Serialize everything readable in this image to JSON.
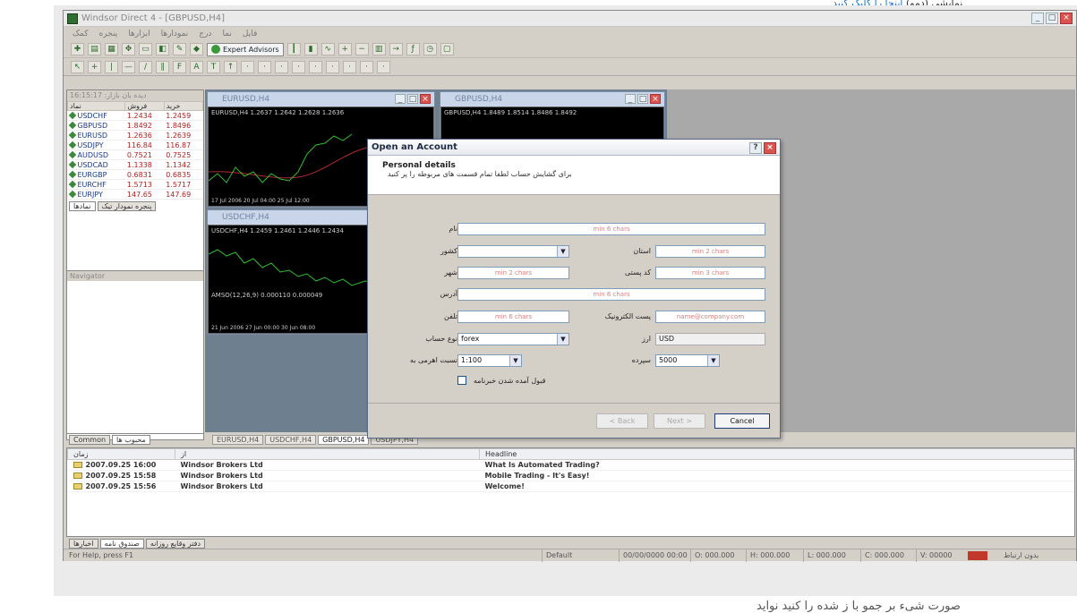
{
  "top_note": {
    "prefix": "نمایشی (دمو)",
    "link": "اینجا را کلیک کنید"
  },
  "window": {
    "title": "Windsor Direct 4 - [GBPUSD,H4]"
  },
  "menu": [
    "فایل",
    "نما",
    "درج",
    "نمودارها",
    "ابزارها",
    "پنجره",
    "کمک"
  ],
  "toolbar": {
    "expert_advisors": "Expert Advisors"
  },
  "market_watch": {
    "header": "دیده بان بازار: 16:15:17",
    "columns": [
      "نماد",
      "فروش",
      "خرید"
    ],
    "rows": [
      {
        "symbol": "USDCHF",
        "bid": "1.2434",
        "ask": "1.2459"
      },
      {
        "symbol": "GBPUSD",
        "bid": "1.8492",
        "ask": "1.8496"
      },
      {
        "symbol": "EURUSD",
        "bid": "1.2636",
        "ask": "1.2639"
      },
      {
        "symbol": "USDJPY",
        "bid": "116.84",
        "ask": "116.87"
      },
      {
        "symbol": "AUDUSD",
        "bid": "0.7521",
        "ask": "0.7525"
      },
      {
        "symbol": "USDCAD",
        "bid": "1.1338",
        "ask": "1.1342"
      },
      {
        "symbol": "EURGBP",
        "bid": "0.6831",
        "ask": "0.6835"
      },
      {
        "symbol": "EURCHF",
        "bid": "1.5713",
        "ask": "1.5717"
      },
      {
        "symbol": "EURJPY",
        "bid": "147.65",
        "ask": "147.69"
      }
    ],
    "tabs": [
      "نمادها",
      "پنجره نمودار تیک"
    ]
  },
  "navigator": {
    "header": "Navigator",
    "tabs": [
      "Common",
      "محبوب ها"
    ]
  },
  "charts": [
    {
      "title": "EURUSD,H4",
      "info": "EURUSD,H4 1.2637 1.2642 1.2628 1.2636",
      "time": "17 Jul 2006  20 Jul 04:00  25 Jul 12:00"
    },
    {
      "title": "GBPUSD,H4",
      "info": "GBPUSD,H4 1.8489 1.8514 1.8486 1.8492",
      "time": ""
    },
    {
      "title": "USDCHF,H4",
      "info": "USDCHF,H4 1.2459 1.2461 1.2446 1.2434",
      "time": "21 Jun 2006  27 Jun 00:00  30 Jun 08:00",
      "sub": "AMSO(12,26,9) 0.000110 0.000049"
    }
  ],
  "chart_tabs": [
    "EURUSD,H4",
    "USDCHF,H4",
    "GBPUSD,H4",
    "USDJPY,H4"
  ],
  "dialog": {
    "title": "Open an Account",
    "heading": "Personal details",
    "instruction": "برای گشایش حساب لطفا تمام قسمت های مربوطه را پر کنید",
    "labels": {
      "name": "نام",
      "country": "کشور",
      "state": "استان",
      "city": "شهر",
      "zip": "کد پستی",
      "address": "آدرس",
      "phone": "تلفن",
      "email": "پست الکترونیک",
      "account_type": "نوع حساب",
      "currency": "ارز",
      "leverage": "نسبت اهرمی به",
      "deposit": "سپرده",
      "newsletter": "قبول آمده شدن خبرنامه"
    },
    "placeholders": {
      "name": "min 6 chars",
      "state": "min 2 chars",
      "city": "min 2 chars",
      "zip": "min 3 chars",
      "address": "min 6 chars",
      "phone": "min 6 chars",
      "email": "name@company.com"
    },
    "values": {
      "account_type": "forex",
      "currency": "USD",
      "leverage": "1:100",
      "deposit": "5000"
    },
    "buttons": {
      "back": "< Back",
      "next": "Next >",
      "cancel": "Cancel"
    }
  },
  "terminal": {
    "columns": [
      "زمان",
      "از",
      "Headline"
    ],
    "rows": [
      {
        "time": "2007.09.25 16:00",
        "from": "Windsor Brokers Ltd",
        "headline": "What Is Automated Trading?"
      },
      {
        "time": "2007.09.25 15:58",
        "from": "Windsor Brokers Ltd",
        "headline": "Mobile Trading - It's Easy!"
      },
      {
        "time": "2007.09.25 15:56",
        "from": "Windsor Brokers Ltd",
        "headline": "Welcome!"
      }
    ],
    "tabs": [
      "اخبارها",
      "صندوق نامه",
      "دفتر وقایع روزانه"
    ]
  },
  "status": {
    "help": "For Help, press F1",
    "profile": "Default",
    "datetime": "00/00/0000 00:00",
    "o": "O: 000.000",
    "h": "H: 000.000",
    "l": "L: 000.000",
    "c": "C: 000.000",
    "v": "V: 00000",
    "conn": "بدون ارتباط"
  },
  "bottom_text": "صورت شیء بر جمو با ز شده را کنید نواید"
}
